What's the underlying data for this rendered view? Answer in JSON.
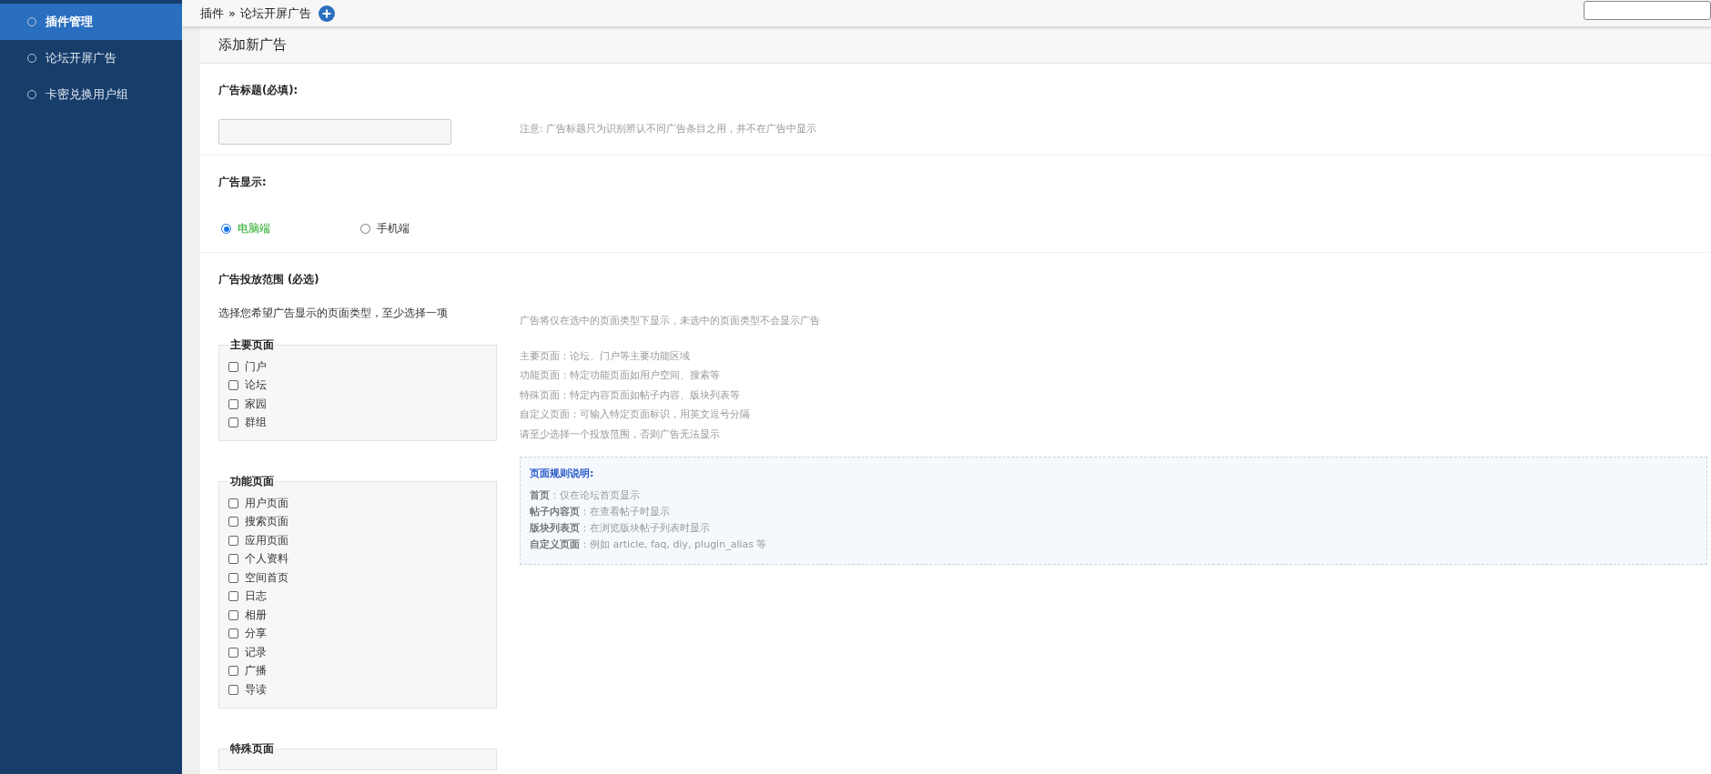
{
  "sidebar": {
    "items": [
      {
        "label": "插件管理",
        "selected": true
      },
      {
        "label": "论坛开屏广告",
        "selected": false
      },
      {
        "label": "卡密兑换用户组",
        "selected": false
      }
    ]
  },
  "breadcrumb": {
    "items": [
      "插件",
      "论坛开屏广告"
    ],
    "separator": "»"
  },
  "panel": {
    "title": "添加新广告",
    "ad_title": {
      "label": "广告标题(必填):",
      "note": "注意: 广告标题只为识别辨认不同广告条目之用，并不在广告中显示"
    },
    "ad_display": {
      "label": "广告显示:",
      "options": [
        {
          "label": "电脑端",
          "selected": true
        },
        {
          "label": "手机端",
          "selected": false
        }
      ]
    },
    "ad_scope": {
      "label": "广告投放范围 (必选)",
      "description": "选择您希望广告显示的页面类型，至少选择一项",
      "groups": [
        {
          "legend": "主要页面",
          "items": [
            {
              "label": "门户",
              "checked": false
            },
            {
              "label": "论坛",
              "checked": false
            },
            {
              "label": "家园",
              "checked": false
            },
            {
              "label": "群组",
              "checked": false
            }
          ]
        },
        {
          "legend": "功能页面",
          "items": [
            {
              "label": "用户页面",
              "checked": false
            },
            {
              "label": "搜索页面",
              "checked": false
            },
            {
              "label": "应用页面",
              "checked": false
            },
            {
              "label": "个人资料",
              "checked": false
            },
            {
              "label": "空间首页",
              "checked": false
            },
            {
              "label": "日志",
              "checked": false
            },
            {
              "label": "相册",
              "checked": false
            },
            {
              "label": "分享",
              "checked": false
            },
            {
              "label": "记录",
              "checked": false
            },
            {
              "label": "广播",
              "checked": false
            },
            {
              "label": "导读",
              "checked": false
            }
          ]
        },
        {
          "legend": "特殊页面"
        }
      ],
      "notes": [
        "广告将仅在选中的页面类型下显示，未选中的页面类型不会显示广告",
        "主要页面：论坛、门户等主要功能区域",
        "功能页面：特定功能页面如用户空间、搜索等",
        "特殊页面：特定内容页面如帖子内容、版块列表等",
        "自定义页面：可输入特定页面标识，用英文逗号分隔",
        "请至少选择一个投放范围，否则广告无法显示"
      ],
      "rules": {
        "title": "页面规则说明:",
        "lines": [
          {
            "term": "首页",
            "text": "：仅在论坛首页显示"
          },
          {
            "term": "帖子内容页",
            "text": "：在查看帖子时显示"
          },
          {
            "term": "版块列表页",
            "text": "：在浏览版块帖子列表时显示"
          },
          {
            "term": "自定义页面",
            "text": "：例如 article, faq, diy, plugin_alias 等"
          }
        ]
      }
    }
  }
}
